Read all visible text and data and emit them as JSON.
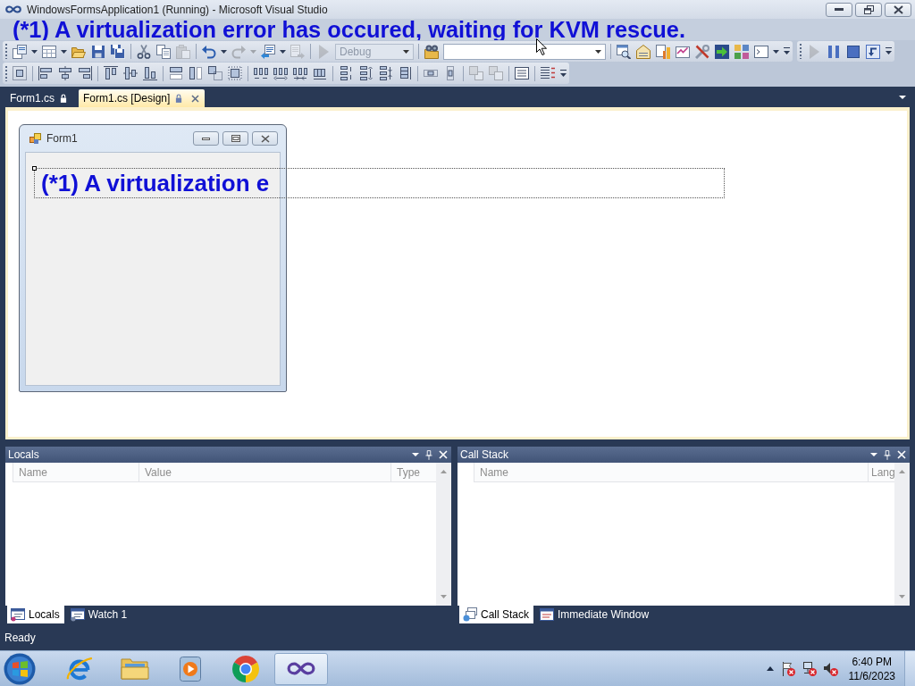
{
  "window": {
    "title": "WindowsFormsApplication1 (Running) - Microsoft Visual Studio"
  },
  "overlay_message": "(*1) A virtualization error has occured, waiting for KVM rescue.",
  "toolbar_rows": [
    {
      "toolbars": [
        {
          "groups": [
            [
              {
                "kind": "new-project",
                "disabled": false
              },
              {
                "kind": "caret",
                "disabled": false
              },
              {
                "kind": "add-item",
                "disabled": false
              },
              {
                "kind": "caret",
                "disabled": false
              },
              {
                "kind": "open",
                "disabled": false
              },
              {
                "kind": "save",
                "disabled": false
              },
              {
                "kind": "save-all",
                "disabled": false
              }
            ],
            [
              {
                "kind": "cut",
                "disabled": false
              },
              {
                "kind": "copy",
                "disabled": false
              },
              {
                "kind": "paste",
                "disabled": true
              }
            ],
            [
              {
                "kind": "undo",
                "disabled": false
              },
              {
                "kind": "caret",
                "disabled": false
              },
              {
                "kind": "redo",
                "disabled": true
              },
              {
                "kind": "caret",
                "disabled": true
              },
              {
                "kind": "navigate-backward",
                "disabled": false
              },
              {
                "kind": "caret",
                "disabled": false
              },
              {
                "kind": "navigate-forward",
                "disabled": true
              }
            ],
            [
              {
                "kind": "start",
                "disabled": true
              },
              {
                "kind": "config-combo",
                "value": "Debug",
                "disabled": true
              }
            ],
            [
              {
                "kind": "find-in-files",
                "disabled": false
              },
              {
                "kind": "find-combo",
                "disabled": false
              }
            ],
            [
              {
                "kind": "solution-explorer",
                "disabled": false
              },
              {
                "kind": "properties",
                "disabled": false
              },
              {
                "kind": "object-browser",
                "disabled": false
              },
              {
                "kind": "toolbox",
                "disabled": false
              },
              {
                "kind": "tools",
                "disabled": false
              },
              {
                "kind": "extension",
                "disabled": false
              },
              {
                "kind": "class-view",
                "disabled": false
              },
              {
                "kind": "command-window",
                "disabled": false
              },
              {
                "kind": "caret",
                "disabled": false
              }
            ]
          ]
        },
        {
          "groups": [
            [
              {
                "kind": "continue",
                "disabled": true
              },
              {
                "kind": "break-all",
                "disabled": false
              },
              {
                "kind": "stop",
                "disabled": false
              },
              {
                "kind": "restart",
                "disabled": false
              }
            ]
          ]
        }
      ]
    },
    {
      "toolbars": [
        {
          "groups": [
            [
              {
                "kind": "align-to-grid",
                "disabled": false
              }
            ],
            [
              {
                "kind": "align-lefts",
                "disabled": false
              },
              {
                "kind": "align-centers",
                "disabled": false
              },
              {
                "kind": "align-rights",
                "disabled": false
              }
            ],
            [
              {
                "kind": "align-tops",
                "disabled": false
              },
              {
                "kind": "align-middles",
                "disabled": false
              },
              {
                "kind": "align-bottoms",
                "disabled": false
              }
            ],
            [
              {
                "kind": "same-width",
                "disabled": false
              },
              {
                "kind": "same-height",
                "disabled": false
              },
              {
                "kind": "same-size",
                "disabled": false
              },
              {
                "kind": "size-to-grid",
                "disabled": false
              }
            ],
            [
              {
                "kind": "h-equal",
                "disabled": false
              },
              {
                "kind": "h-increase",
                "disabled": false
              },
              {
                "kind": "h-decrease",
                "disabled": false
              },
              {
                "kind": "h-remove",
                "disabled": false
              }
            ],
            [
              {
                "kind": "v-equal",
                "disabled": false
              },
              {
                "kind": "v-increase",
                "disabled": false
              },
              {
                "kind": "v-decrease",
                "disabled": false
              },
              {
                "kind": "v-remove",
                "disabled": false
              }
            ],
            [
              {
                "kind": "center-horizontally",
                "disabled": false
              },
              {
                "kind": "center-vertically",
                "disabled": false
              }
            ],
            [
              {
                "kind": "bring-to-front",
                "disabled": true
              },
              {
                "kind": "send-to-back",
                "disabled": true
              }
            ],
            [
              {
                "kind": "tab-order",
                "disabled": false
              }
            ],
            [
              {
                "kind": "list-layout",
                "disabled": false
              }
            ]
          ]
        }
      ]
    }
  ],
  "document_tabs": [
    {
      "label": "Form1.cs",
      "selected": false
    },
    {
      "label": "Form1.cs [Design]",
      "selected": true
    }
  ],
  "designer": {
    "form": {
      "title": "Form1",
      "label": "(*1) A virtualization e"
    }
  },
  "tool_panels": [
    {
      "title": "Locals",
      "columns": [
        "Name",
        "Value",
        "Type"
      ],
      "tabs": [
        {
          "label": "Locals",
          "kind": "locals",
          "selected": true
        },
        {
          "label": "Watch 1",
          "kind": "watch",
          "selected": false
        }
      ]
    },
    {
      "title": "Call Stack",
      "columns": [
        "Name",
        "Lang"
      ],
      "tabs": [
        {
          "label": "Call Stack",
          "kind": "call-stack",
          "selected": true
        },
        {
          "label": "Immediate Window",
          "kind": "immediate",
          "selected": false
        }
      ]
    }
  ],
  "status_bar": {
    "text": "Ready"
  },
  "taskbar": {
    "apps": [
      {
        "kind": "internet-explorer",
        "selected": false
      },
      {
        "kind": "file-explorer",
        "selected": false
      },
      {
        "kind": "media-player",
        "selected": false
      },
      {
        "kind": "chrome",
        "selected": false
      },
      {
        "kind": "visual-studio",
        "selected": true
      }
    ],
    "clock": {
      "time": "6:40 PM",
      "date": "11/6/2023"
    }
  }
}
